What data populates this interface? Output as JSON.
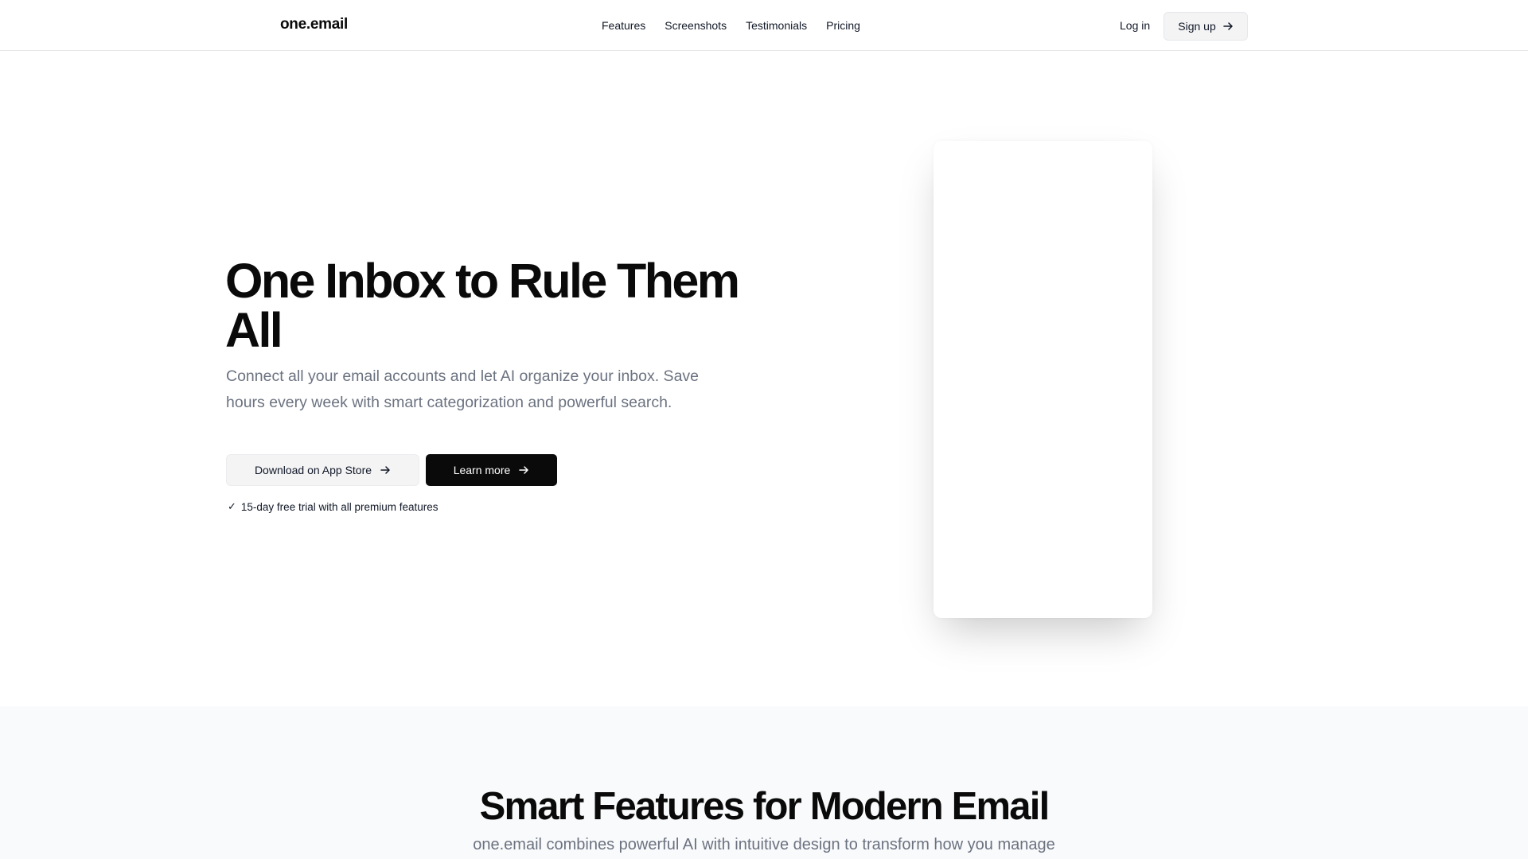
{
  "header": {
    "logo": "one.email",
    "nav": [
      "Features",
      "Screenshots",
      "Testimonials",
      "Pricing"
    ],
    "login_label": "Log in",
    "signup_label": "Sign up"
  },
  "hero": {
    "title": "One Inbox to Rule Them All",
    "subtitle": "Connect all your email accounts and let AI organize your inbox. Save hours every week with smart categorization and powerful search.",
    "download_label": "Download on App Store",
    "learn_label": "Learn more",
    "trial_text": "15-day free trial with all premium features"
  },
  "features": {
    "title": "Smart Features for Modern Email",
    "subtitle": "one.email combines powerful AI with intuitive design to transform how you manage"
  },
  "icons": {
    "arrow": "arrow-right-icon",
    "check": "check-icon"
  }
}
